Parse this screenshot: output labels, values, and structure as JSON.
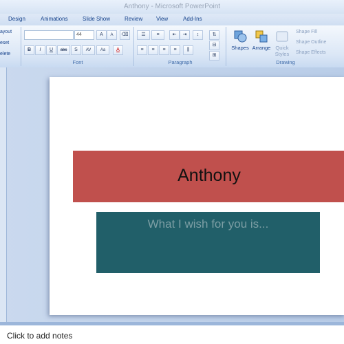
{
  "window": {
    "title": "Anthony - Microsoft PowerPoint"
  },
  "tabs": [
    "Design",
    "Animations",
    "Slide Show",
    "Review",
    "View",
    "Add-Ins"
  ],
  "ribbon": {
    "slides_group": {
      "layout": "ayout",
      "reset": "eset",
      "delete": "elete"
    },
    "font_group": {
      "label": "Font",
      "font_name": "",
      "font_size": "44",
      "grow": "A",
      "shrink": "A",
      "bold": "B",
      "italic": "I",
      "underline": "U",
      "strike": "abc",
      "shadow": "S",
      "spacing": "AV",
      "case": "Aa",
      "color": "A"
    },
    "paragraph_group": {
      "label": "Paragraph"
    },
    "drawing_group": {
      "label": "Drawing",
      "shapes": "Shapes",
      "arrange": "Arrange",
      "quick_styles": "Quick Styles",
      "shape_fill": "Shape Fill",
      "shape_outline": "Shape Outline",
      "shape_effects": "Shape Effects"
    }
  },
  "slide": {
    "title": "Anthony",
    "subtitle": "What I wish for you is...",
    "title_fill": "#c0504d",
    "subtitle_fill": "#215f69"
  },
  "notes": {
    "placeholder": "Click to add notes"
  }
}
